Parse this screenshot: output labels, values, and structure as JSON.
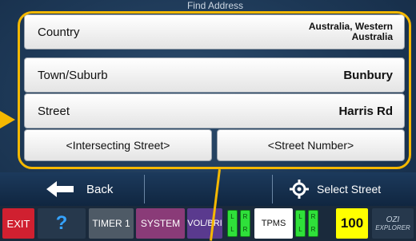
{
  "screen": {
    "title": "Find Address"
  },
  "fields": [
    {
      "label": "Country",
      "value_line1": "Australia, Western",
      "value_line2": "Australia"
    },
    {
      "label": "Town/Suburb",
      "value": "Bunbury"
    },
    {
      "label": "Street",
      "value": "Harris Rd"
    }
  ],
  "buttons": {
    "intersecting": "<Intersecting Street>",
    "street_number": "<Street Number>"
  },
  "nav": {
    "back": "Back",
    "select_street": "Select Street"
  },
  "toolbar": {
    "exit": "EXIT",
    "help": "?",
    "timer": "TIMER 1",
    "system": "SYSTEM",
    "volbri": "VOL/BRI",
    "tpms": "TPMS",
    "tpms_left_top": "L",
    "tpms_left_bottom": "L",
    "tpms_right_top": "R",
    "tpms_right_bottom": "R",
    "speed": "100",
    "ozi_top": "OZI",
    "ozi_bottom": "EXPLORER"
  },
  "colors": {
    "highlight": "#f5b800",
    "exit_bg": "#d02030",
    "help": "#35a3ff",
    "timer_bg": "#4e5a66",
    "system_bg": "#8a3b78",
    "volbri_bg": "#5a3a8e",
    "tpms_indicator": "#2fe03a",
    "speed_bg": "#ffff00"
  }
}
